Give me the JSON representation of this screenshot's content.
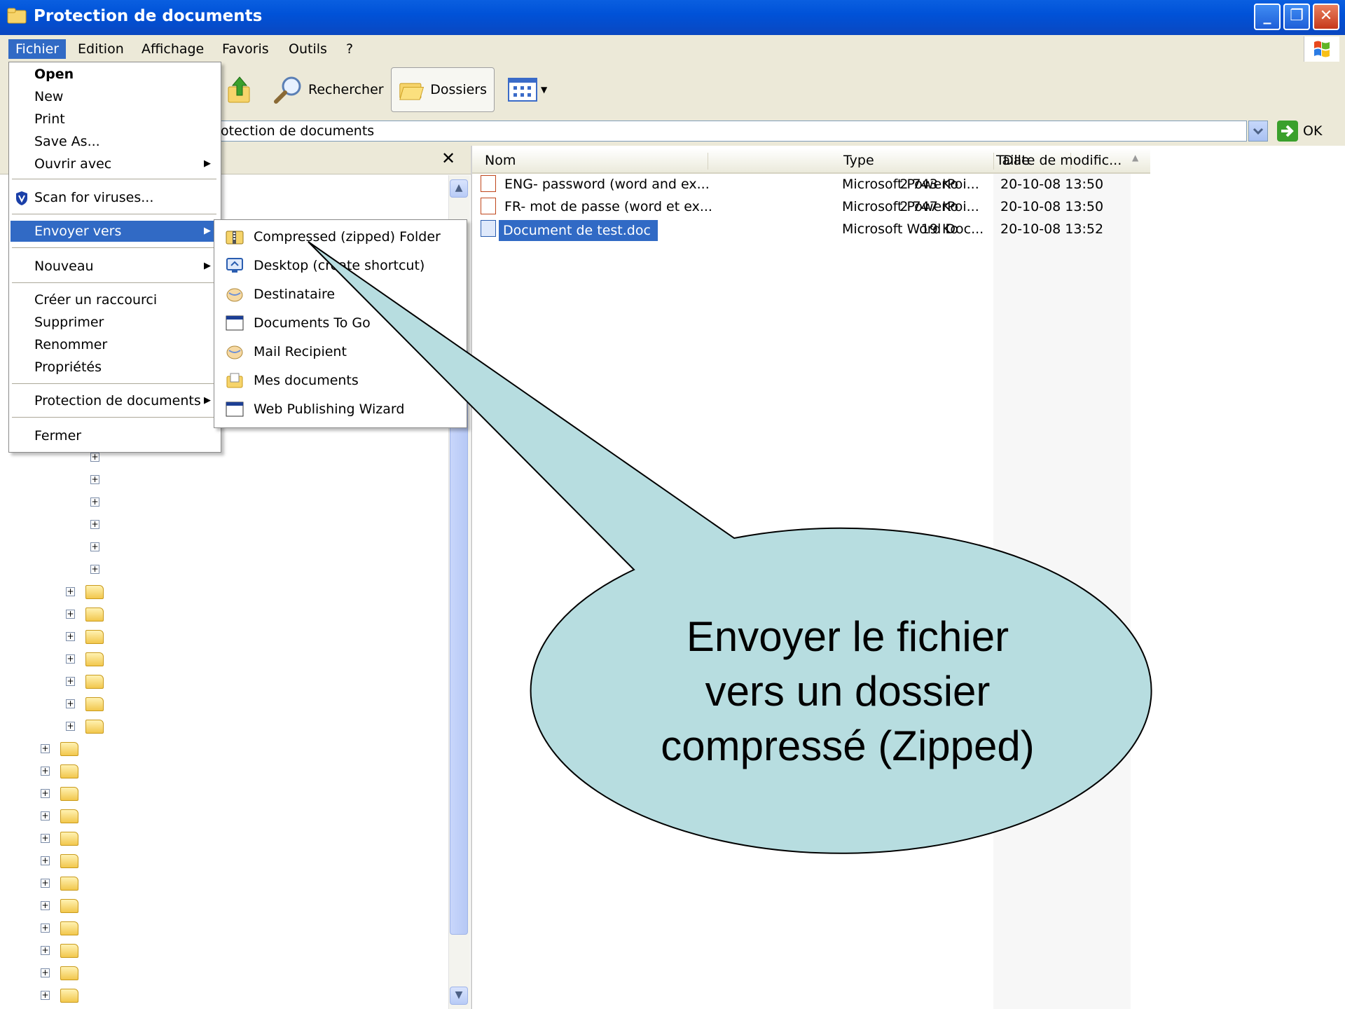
{
  "window": {
    "title": "Protection de documents"
  },
  "menubar": {
    "items": [
      "Fichier",
      "Edition",
      "Affichage",
      "Favoris",
      "Outils",
      "?"
    ]
  },
  "toolbar": {
    "search_label": "Rechercher",
    "folders_label": "Dossiers"
  },
  "address": {
    "value": "otection de documents",
    "go_label": "OK"
  },
  "folder_pane": {
    "close_glyph": "✕"
  },
  "file_list": {
    "columns": [
      "Nom",
      "Taille",
      "Type",
      "Date de modific..."
    ],
    "rows": [
      {
        "name": "ENG- password (word and ex...",
        "size": "2 743 Ko",
        "type": "Microsoft PowerPoi...",
        "date": "20-10-08 13:50",
        "icon": "powerpoint-file-icon"
      },
      {
        "name": "FR- mot de passe (word et ex...",
        "size": "2 747 Ko",
        "type": "Microsoft PowerPoi...",
        "date": "20-10-08 13:50",
        "icon": "powerpoint-file-icon"
      },
      {
        "name": "Document de test.doc",
        "size": "19 Ko",
        "type": "Microsoft Word Doc...",
        "date": "20-10-08 13:52",
        "icon": "word-file-icon",
        "selected": true
      }
    ]
  },
  "file_menu": {
    "items": [
      {
        "label": "Open",
        "bold": true
      },
      {
        "label": "New"
      },
      {
        "label": "Print"
      },
      {
        "label": "Save As..."
      },
      {
        "label": "Ouvrir avec",
        "submenu": true
      },
      {
        "label": "Scan for viruses..."
      },
      {
        "label": "Envoyer vers",
        "submenu": true,
        "highlighted": true
      },
      {
        "label": "Nouveau",
        "submenu": true
      },
      {
        "label": "Créer un raccourci"
      },
      {
        "label": "Supprimer"
      },
      {
        "label": "Renommer"
      },
      {
        "label": "Propriétés"
      },
      {
        "label": "Protection de documents",
        "submenu": true
      },
      {
        "label": "Fermer"
      }
    ]
  },
  "send_to_menu": {
    "items": [
      {
        "label": "Compressed (zipped) Folder",
        "icon": "zip-folder-icon"
      },
      {
        "label": "Desktop (create shortcut)",
        "icon": "desktop-icon"
      },
      {
        "label": "Destinataire",
        "icon": "mail-recipient-icon"
      },
      {
        "label": "Documents To Go",
        "icon": "application-window-icon"
      },
      {
        "label": "Mail Recipient",
        "icon": "mail-recipient-icon"
      },
      {
        "label": "Mes documents",
        "icon": "my-documents-icon"
      },
      {
        "label": "Web Publishing Wizard",
        "icon": "application-window-icon"
      }
    ]
  },
  "callout": {
    "text": "Envoyer le fichier\nvers un dossier\ncompressé (Zipped)"
  },
  "colors": {
    "titlebar": "#0a5fe0",
    "highlight": "#316ac5",
    "callout_fill": "#b7dde0",
    "chrome": "#ece9d8"
  }
}
